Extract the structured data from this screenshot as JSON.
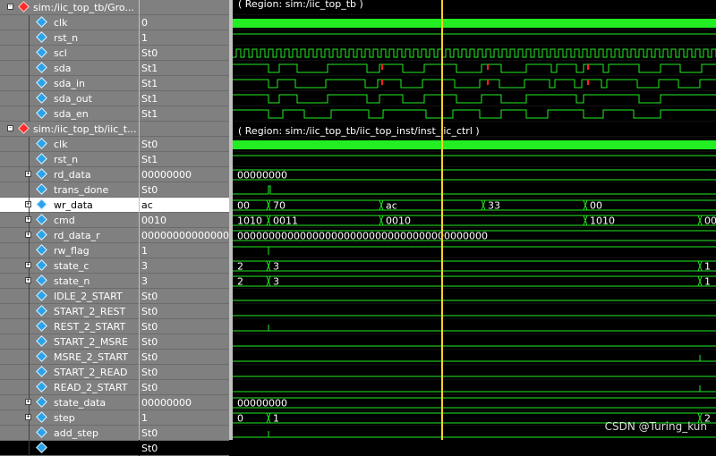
{
  "signals": [
    {
      "id": "grp1",
      "name": "sim:/iic_top_tb/Gro...",
      "value": "",
      "icon": "group",
      "level": 0,
      "expand": "-"
    },
    {
      "id": "clk1",
      "name": "clk",
      "value": "0",
      "icon": "sig",
      "level": 1
    },
    {
      "id": "rstn1",
      "name": "rst_n",
      "value": "1",
      "icon": "sig",
      "level": 1
    },
    {
      "id": "scl",
      "name": "scl",
      "value": "St0",
      "icon": "sig",
      "level": 1
    },
    {
      "id": "sda",
      "name": "sda",
      "value": "St1",
      "icon": "sig",
      "level": 1
    },
    {
      "id": "sda_in",
      "name": "sda_in",
      "value": "St1",
      "icon": "sig",
      "level": 1
    },
    {
      "id": "sda_out",
      "name": "sda_out",
      "value": "St1",
      "icon": "sig",
      "level": 1
    },
    {
      "id": "sda_en",
      "name": "sda_en",
      "value": "St1",
      "icon": "sig",
      "level": 1
    },
    {
      "id": "grp2",
      "name": "sim:/iic_top_tb/iic_t...",
      "value": "",
      "icon": "group",
      "level": 0,
      "expand": "-"
    },
    {
      "id": "clk2",
      "name": "clk",
      "value": "St0",
      "icon": "sig",
      "level": 1
    },
    {
      "id": "rstn2",
      "name": "rst_n",
      "value": "St1",
      "icon": "sig",
      "level": 1
    },
    {
      "id": "rd_data",
      "name": "rd_data",
      "value": "00000000",
      "icon": "bus",
      "level": 1,
      "expand": "+"
    },
    {
      "id": "trans_done",
      "name": "trans_done",
      "value": "St0",
      "icon": "sig",
      "level": 1
    },
    {
      "id": "wr_data",
      "name": "wr_data",
      "value": "ac",
      "icon": "bus",
      "level": 1,
      "expand": "+",
      "selected": true
    },
    {
      "id": "cmd",
      "name": "cmd",
      "value": "0010",
      "icon": "bus",
      "level": 1,
      "expand": "+"
    },
    {
      "id": "rd_data_r",
      "name": "rd_data_r",
      "value": "00000000000000...",
      "icon": "bus",
      "level": 1,
      "expand": "+"
    },
    {
      "id": "rw_flag",
      "name": "rw_flag",
      "value": "1",
      "icon": "sig",
      "level": 1
    },
    {
      "id": "state_c",
      "name": "state_c",
      "value": "3",
      "icon": "bus",
      "level": 1,
      "expand": "+"
    },
    {
      "id": "state_n",
      "name": "state_n",
      "value": "3",
      "icon": "bus",
      "level": 1,
      "expand": "+"
    },
    {
      "id": "idle2start",
      "name": "IDLE_2_START",
      "value": "St0",
      "icon": "sig",
      "level": 1
    },
    {
      "id": "start2rest",
      "name": "START_2_REST",
      "value": "St0",
      "icon": "sig",
      "level": 1
    },
    {
      "id": "rest2start",
      "name": "REST_2_START",
      "value": "St0",
      "icon": "sig",
      "level": 1
    },
    {
      "id": "start2msre",
      "name": "START_2_MSRE",
      "value": "St0",
      "icon": "sig",
      "level": 1
    },
    {
      "id": "msre2start",
      "name": "MSRE_2_START",
      "value": "St0",
      "icon": "sig",
      "level": 1
    },
    {
      "id": "start2read",
      "name": "START_2_READ",
      "value": "St0",
      "icon": "sig",
      "level": 1
    },
    {
      "id": "read2start",
      "name": "READ_2_START",
      "value": "St0",
      "icon": "sig",
      "level": 1
    },
    {
      "id": "state_data",
      "name": "state_data",
      "value": "00000000",
      "icon": "bus",
      "level": 1,
      "expand": "+"
    },
    {
      "id": "step",
      "name": "step",
      "value": "1",
      "icon": "bus",
      "level": 1,
      "expand": "+"
    },
    {
      "id": "add_step",
      "name": "add_step",
      "value": "St0",
      "icon": "sig",
      "level": 1
    },
    {
      "id": "more",
      "name": "",
      "value": "St0",
      "icon": "sig",
      "level": 1
    }
  ],
  "region1_label": "( Region: sim:/iic_top_tb )",
  "region2_label": "( Region: sim:/iic_top_tb/iic_top_inst/inst_iic_ctrl )",
  "bus_labels": {
    "rd_data": [
      [
        "00000000",
        0
      ]
    ],
    "wr_data": [
      [
        "00",
        0
      ],
      [
        "70",
        40
      ],
      [
        "ac",
        166
      ],
      [
        "33",
        280
      ],
      [
        "00",
        394
      ]
    ],
    "cmd": [
      [
        "1010",
        0
      ],
      [
        "0011",
        40
      ],
      [
        "0010",
        166
      ],
      [
        "1010",
        394
      ],
      [
        "00",
        522
      ]
    ],
    "rd_data_r": [
      [
        "0000000000000000000000000000000000000000",
        0
      ]
    ],
    "state_c": [
      [
        "2",
        0
      ],
      [
        "3",
        40
      ],
      [
        "1",
        522
      ]
    ],
    "state_n": [
      [
        "2",
        0
      ],
      [
        "3",
        40
      ],
      [
        "1",
        522
      ]
    ],
    "state_data": [
      [
        "00000000",
        0
      ]
    ],
    "step": [
      [
        "0",
        0
      ],
      [
        "1",
        40
      ],
      [
        "2",
        522
      ]
    ]
  },
  "colors": {
    "wave": "#22ee22",
    "cursor": "#ffd21f",
    "marker": "#ff2020",
    "text": "#ffffff",
    "grid": "#1a3a1a"
  },
  "watermark": "CSDN @Turing_kun"
}
